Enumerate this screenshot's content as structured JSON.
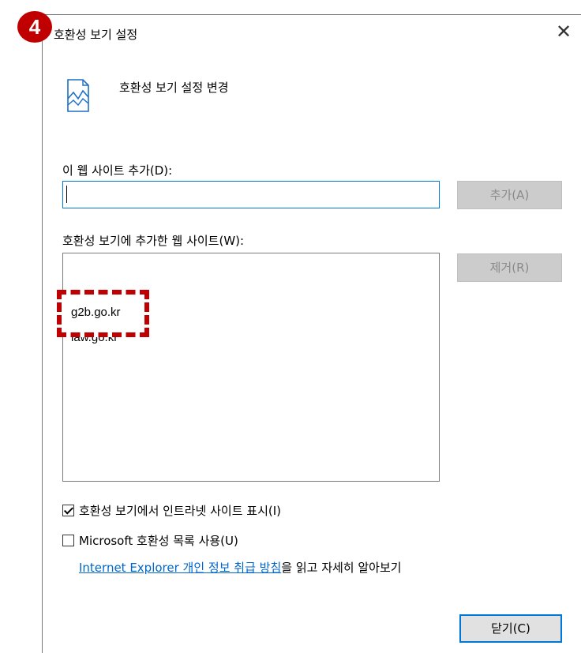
{
  "step_badge": "4",
  "dialog": {
    "title": "호환성 보기 설정",
    "header": "호환성 보기 설정 변경"
  },
  "add_section": {
    "label": "이 웹 사이트 추가(D):",
    "input_value": "",
    "add_button": "추가(A)"
  },
  "list_section": {
    "label": "호환성 보기에 추가한 웹 사이트(W):",
    "remove_button": "제거(R)",
    "sites": [
      "g2b.go.kr",
      "law.go.kr"
    ]
  },
  "options": {
    "intranet": {
      "label": "호환성 보기에서 인트라넷 사이트 표시(I)",
      "checked": true
    },
    "ms_list": {
      "label": "Microsoft 호환성 목록 사용(U)",
      "checked": false
    }
  },
  "policy": {
    "link_text": "Internet Explorer 개인 정보 취급 방침",
    "suffix": "을 읽고 자세히 알아보기"
  },
  "close_button": "닫기(C)",
  "colors": {
    "accent": "#0078d7",
    "highlight": "#c00000",
    "link": "#0066cc"
  }
}
